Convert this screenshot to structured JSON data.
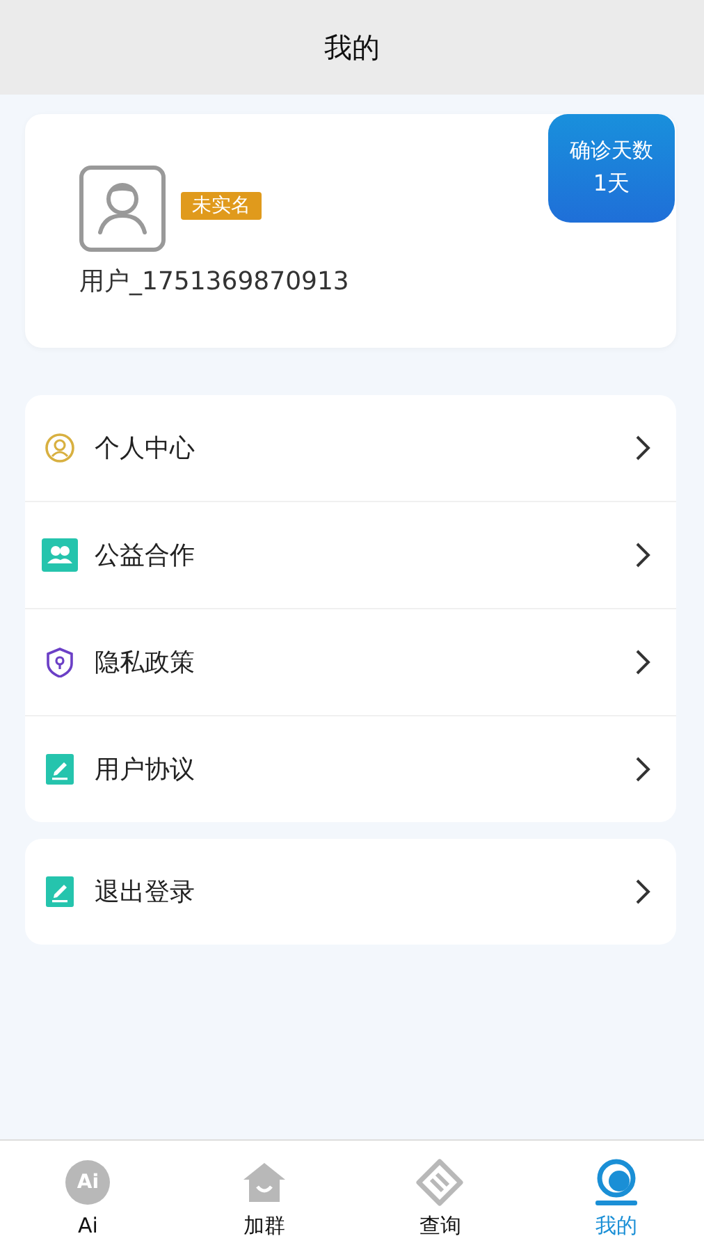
{
  "header": {
    "title": "我的"
  },
  "profile": {
    "status_badge": "未实名",
    "username": "用户_1751369870913",
    "days_badge": {
      "label": "确诊天数",
      "value": "1天"
    }
  },
  "menu_groups": [
    {
      "items": [
        {
          "kind": "person",
          "label": "个人中心"
        },
        {
          "kind": "group",
          "label": "公益合作"
        },
        {
          "kind": "shield",
          "label": "隐私政策"
        },
        {
          "kind": "edit",
          "label": "用户协议"
        }
      ]
    },
    {
      "items": [
        {
          "kind": "edit",
          "label": "退出登录"
        }
      ]
    }
  ],
  "tab_bar": [
    {
      "kind": "ai",
      "icon_text": "Ai",
      "label": "Ai",
      "selected": false
    },
    {
      "kind": "house",
      "label": "加群",
      "selected": false
    },
    {
      "kind": "diamond",
      "label": "查询",
      "selected": false
    },
    {
      "kind": "mine",
      "label": "我的",
      "selected": true
    }
  ]
}
